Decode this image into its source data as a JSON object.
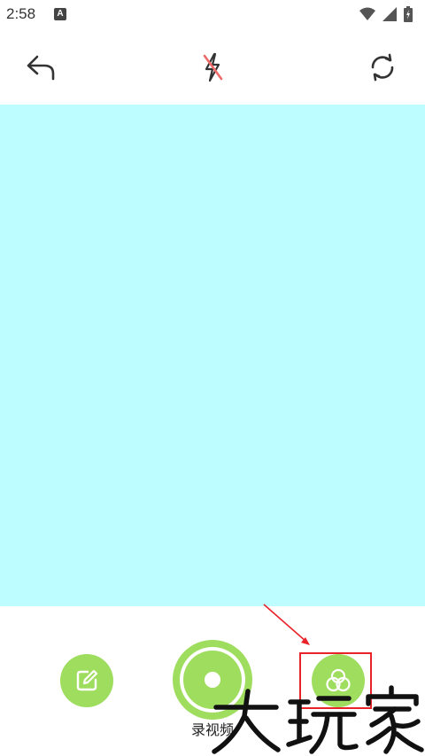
{
  "status_bar": {
    "time": "2:58",
    "notification_letter": "A"
  },
  "toolbar": {
    "back_icon": "back-arrow-icon",
    "flash_icon": "flash-off-icon",
    "switch_icon": "switch-camera-icon"
  },
  "camera_preview": {
    "color": "#bdfdff"
  },
  "controls": {
    "edit_icon": "edit-icon",
    "record_label": "录视频",
    "filter_icon": "filter-icon",
    "accent_color": "#9fdd5f"
  },
  "annotation": {
    "highlight_color": "#e8232a"
  },
  "watermark": {
    "text": "大玩家"
  }
}
